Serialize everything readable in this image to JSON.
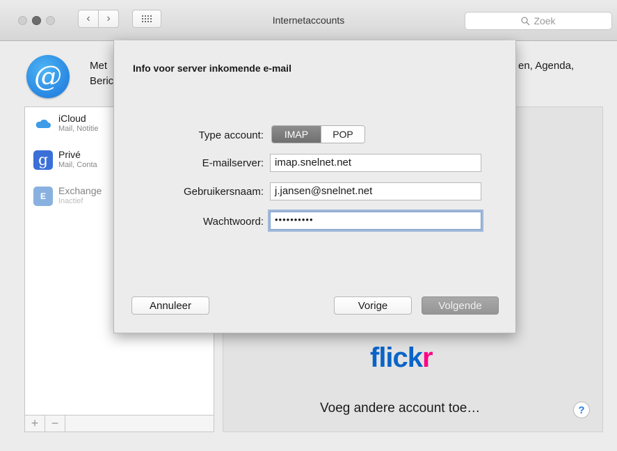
{
  "window": {
    "title": "Internetaccounts"
  },
  "search": {
    "placeholder": "Zoek"
  },
  "icons": {
    "back": "chevron-left-icon",
    "forward": "chevron-right-icon",
    "grid": "grid-icon",
    "search": "magnifier-icon",
    "internet_accounts": "at-sign-icon"
  },
  "header": {
    "line1_left": "Met",
    "line2_left": "Beric",
    "line1_right": "en, Agenda,"
  },
  "accounts": [
    {
      "name": "iCloud",
      "subtitle": "Mail, Notitie",
      "icon": "icloud-icon"
    },
    {
      "name": "Privé",
      "subtitle": "Mail, Conta",
      "icon": "google-icon"
    },
    {
      "name": "Exchange",
      "subtitle": "Inactief",
      "icon": "exchange-icon"
    }
  ],
  "list_footer": {
    "add": "+",
    "remove": "−"
  },
  "right_panel": {
    "flickr_a": "flick",
    "flickr_b": "r",
    "add_other": "Voeg andere account toe…",
    "help": "?"
  },
  "sheet": {
    "title": "Info voor server inkomende e-mail",
    "type_label": "Type account:",
    "type_options": [
      "IMAP",
      "POP"
    ],
    "type_selected": "IMAP",
    "server_label": "E-mailserver:",
    "server_value": "imap.snelnet.net",
    "user_label": "Gebruikersnaam:",
    "user_value": "j.jansen@snelnet.net",
    "password_label": "Wachtwoord:",
    "password_value": "••••••••••",
    "cancel": "Annuleer",
    "back": "Vorige",
    "next": "Volgende"
  }
}
